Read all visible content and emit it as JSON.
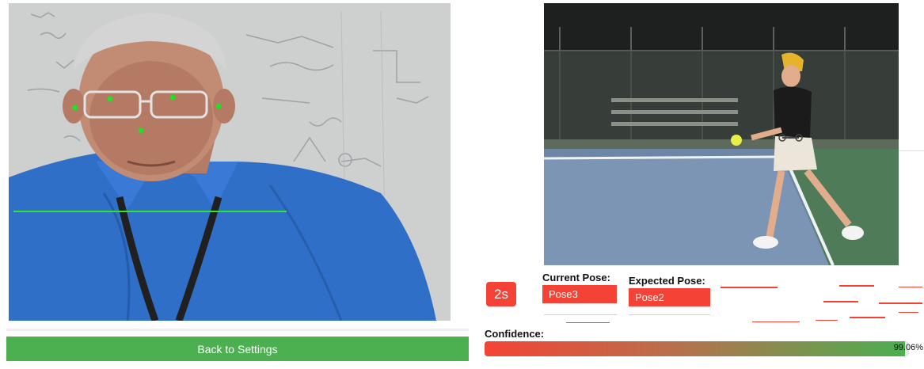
{
  "left_panel": {
    "webcam_icon": "webcam-feed",
    "back_button_label": "Back to Settings"
  },
  "right_panel": {
    "reference_icon": "reference-video",
    "timer": "2s",
    "current_pose_label": "Current Pose:",
    "current_pose_value": "Pose3",
    "expected_pose_label": "Expected Pose:",
    "expected_pose_value": "Pose2",
    "confidence_label": "Confidence:",
    "confidence_value": "99.06%",
    "confidence_fraction": 0.9906
  },
  "colors": {
    "accent_green": "#4caf50",
    "accent_red": "#f44336",
    "landmark_green": "#22e022"
  }
}
